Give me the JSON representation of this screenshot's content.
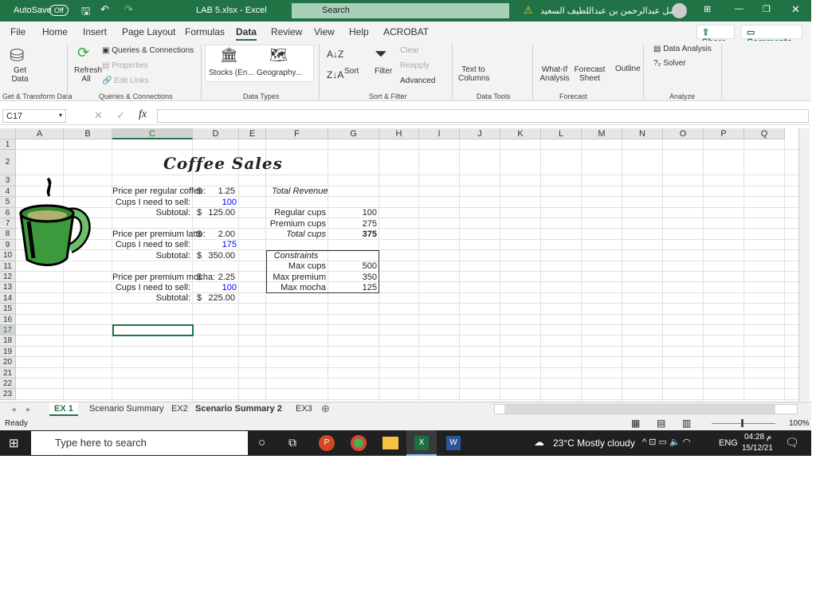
{
  "titlebar": {
    "autosave": "AutoSave",
    "toggle": "Off",
    "file": "LAB 5.xlsx  -  Excel",
    "search": "Search",
    "user": "فيصل عبدالرحمن بن عبداللطيف السعيد"
  },
  "menu": [
    "File",
    "Home",
    "Insert",
    "Page Layout",
    "Formulas",
    "Data",
    "Review",
    "View",
    "Help",
    "ACROBAT"
  ],
  "share": "Share",
  "comments": "Comments",
  "ribbon": {
    "get_data": "Get Data",
    "queries": "Queries & Connections",
    "properties": "Properties",
    "edit_links": "Edit Links",
    "refresh": "Refresh All",
    "stocks": "Stocks (En...",
    "geography": "Geography...",
    "sort": "Sort",
    "filter": "Filter",
    "clear": "Clear",
    "reapply": "Reapply",
    "advanced": "Advanced",
    "text_to_columns": "Text to Columns",
    "what_if": "What-If Analysis",
    "forecast_sheet": "Forecast Sheet",
    "outline": "Outline",
    "data_analysis": "Data Analysis",
    "solver": "Solver",
    "groups": [
      "Get & Transform Data",
      "Queries & Connections",
      "Data Types",
      "Sort & Filter",
      "Data Tools",
      "Forecast",
      "Analyze"
    ]
  },
  "namebox": "C17",
  "formula": "",
  "columns": [
    "A",
    "B",
    "C",
    "D",
    "E",
    "F",
    "G",
    "H",
    "I",
    "J",
    "K",
    "L",
    "M",
    "N",
    "O",
    "P",
    "Q"
  ],
  "rows": [
    "1",
    "2",
    "3",
    "4",
    "5",
    "6",
    "7",
    "8",
    "9",
    "10",
    "11",
    "12",
    "13",
    "14",
    "15",
    "16",
    "17",
    "18",
    "19",
    "20",
    "21",
    "22",
    "23"
  ],
  "sheet": {
    "title": "Coffee Sales",
    "cells": [
      {
        "r": 4,
        "c": "C",
        "v": "Price per regular coffee:"
      },
      {
        "r": 4,
        "c": "D$",
        "v": "$"
      },
      {
        "r": 4,
        "c": "D",
        "v": "1.25"
      },
      {
        "r": 5,
        "c": "C",
        "v": "Cups I need to sell:"
      },
      {
        "r": 5,
        "c": "D",
        "v": "100",
        "color": "#0000ff"
      },
      {
        "r": 6,
        "c": "C",
        "v": "Subtotal:"
      },
      {
        "r": 6,
        "c": "D$",
        "v": "$"
      },
      {
        "r": 6,
        "c": "D",
        "v": "125.00"
      },
      {
        "r": 8,
        "c": "C",
        "v": "Price per premium latte:"
      },
      {
        "r": 8,
        "c": "D$",
        "v": "$"
      },
      {
        "r": 8,
        "c": "D",
        "v": "2.00"
      },
      {
        "r": 9,
        "c": "C",
        "v": "Cups I need to sell:"
      },
      {
        "r": 9,
        "c": "D",
        "v": "175",
        "color": "#0000ff"
      },
      {
        "r": 10,
        "c": "C",
        "v": "Subtotal:"
      },
      {
        "r": 10,
        "c": "D$",
        "v": "$"
      },
      {
        "r": 10,
        "c": "D",
        "v": "350.00"
      },
      {
        "r": 12,
        "c": "C",
        "v": "Price per premium mocha:"
      },
      {
        "r": 12,
        "c": "D$",
        "v": "$"
      },
      {
        "r": 12,
        "c": "D",
        "v": "2.25"
      },
      {
        "r": 13,
        "c": "C",
        "v": "Cups I need to sell:"
      },
      {
        "r": 13,
        "c": "D",
        "v": "100",
        "color": "#0000ff"
      },
      {
        "r": 14,
        "c": "C",
        "v": "Subtotal:"
      },
      {
        "r": 14,
        "c": "D$",
        "v": "$"
      },
      {
        "r": 14,
        "c": "D",
        "v": "225.00"
      },
      {
        "r": 4,
        "c": "F",
        "v": "Total Revenue",
        "italic": true
      },
      {
        "r": 6,
        "c": "F",
        "v": "Regular cups"
      },
      {
        "r": 6,
        "c": "G",
        "v": "100"
      },
      {
        "r": 7,
        "c": "F",
        "v": "Premium cups"
      },
      {
        "r": 7,
        "c": "G",
        "v": "275"
      },
      {
        "r": 8,
        "c": "F",
        "v": "Total cups",
        "italic": true
      },
      {
        "r": 8,
        "c": "G",
        "v": "375",
        "bold": true
      },
      {
        "r": 10,
        "c": "F",
        "v": "Constraints",
        "italic": true
      },
      {
        "r": 11,
        "c": "F",
        "v": "Max cups"
      },
      {
        "r": 11,
        "c": "G",
        "v": "500"
      },
      {
        "r": 12,
        "c": "F",
        "v": "Max premium"
      },
      {
        "r": 12,
        "c": "G",
        "v": "350"
      },
      {
        "r": 13,
        "c": "F",
        "v": "Max mocha"
      },
      {
        "r": 13,
        "c": "G",
        "v": "125"
      }
    ]
  },
  "tabs": [
    {
      "label": "EX 1",
      "active": true
    },
    {
      "label": "Scenario Summary"
    },
    {
      "label": "EX2"
    },
    {
      "label": "Scenario Summary 2",
      "bold": true
    },
    {
      "label": "EX3"
    }
  ],
  "status": {
    "ready": "Ready",
    "zoom": "100%"
  },
  "taskbar": {
    "search": "Type here to search",
    "weather": "23°C  Mostly cloudy",
    "lang": "ENG",
    "time": "04:28 م",
    "date": "15/12/21"
  },
  "colors": {
    "excel_green": "#217346",
    "input_blue": "#0000ff",
    "mug_green": "#3c9a3c"
  }
}
